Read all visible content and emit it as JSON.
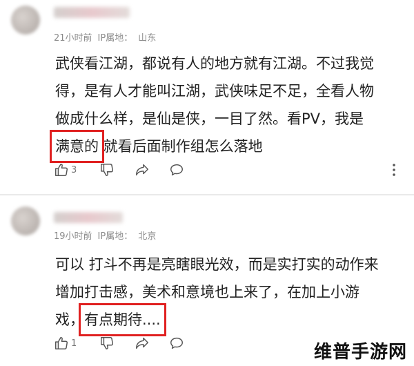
{
  "comments": [
    {
      "time": "21小时前",
      "ip_label": "IP属地：",
      "location": "山东",
      "lines": [
        "武侠看江湖，都说有人的地方就有江湖。不过我觉",
        "得，是有人才能叫江湖，武侠味足不足，全看人物",
        "做成什么样，是仙是侠，一目了然。看PV，我是"
      ],
      "last_highlight": "满意的",
      "last_rest": " 就看后面制作组怎么落地",
      "likes": "3"
    },
    {
      "time": "19小时前",
      "ip_label": "IP属地：",
      "location": "北京",
      "lines": [
        "可以 打斗不再是亮瞎眼光效，而是实打实的动作来",
        "增加打击感，美术和意境也上来了，在加上小游"
      ],
      "last_prefix": "戏，",
      "last_highlight": "有点期待....",
      "likes": "1"
    }
  ],
  "icons": {
    "like": "thumbs-up-icon",
    "dislike": "thumbs-down-icon",
    "share": "share-icon",
    "comment": "comment-icon",
    "more": "more-vertical-icon"
  },
  "colors": {
    "highlight_border": "#e02020",
    "meta": "#8a8a8a"
  },
  "watermark": "维普手游网"
}
